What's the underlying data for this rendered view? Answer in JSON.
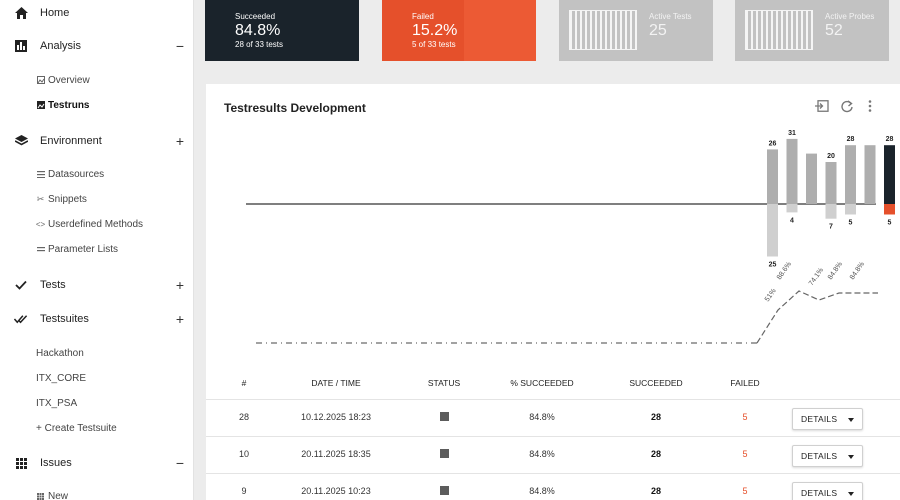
{
  "sidebar": {
    "home": {
      "label": "Home"
    },
    "analysis": {
      "label": "Analysis",
      "toggle": "−",
      "items": [
        {
          "label": "Overview"
        },
        {
          "label": "Testruns"
        }
      ]
    },
    "environment": {
      "label": "Environment",
      "toggle": "+",
      "items": [
        {
          "label": "Datasources"
        },
        {
          "label": "Snippets"
        },
        {
          "label": "Userdefined Methods"
        },
        {
          "label": "Parameter Lists"
        }
      ]
    },
    "tests": {
      "label": "Tests",
      "toggle": "+"
    },
    "testsuites": {
      "label": "Testsuites",
      "toggle": "+",
      "items": [
        {
          "label": "Hackathon"
        },
        {
          "label": "ITX_CORE"
        },
        {
          "label": "ITX_PSA"
        },
        {
          "label": "+ Create Testsuite"
        }
      ]
    },
    "issues": {
      "label": "Issues",
      "toggle": "−",
      "items": [
        {
          "label": "New"
        }
      ]
    }
  },
  "kpis": {
    "succeeded": {
      "title": "Succeeded",
      "value": "84.8%",
      "sub": "28 of 33 tests",
      "color": "#1a232b"
    },
    "failed": {
      "title": "Failed",
      "value": "15.2%",
      "sub": "5 of 33 tests",
      "color": "#e5502b"
    },
    "active_tests": {
      "title": "Active Tests",
      "value": "25"
    },
    "active_probes": {
      "title": "Active Probes",
      "value": "52"
    }
  },
  "card": {
    "title": "Testresults Development",
    "tools": [
      "import-icon",
      "refresh-icon",
      "more-vert-icon"
    ]
  },
  "chart_data": {
    "type": "bar",
    "series": [
      {
        "values": [
          26,
          31,
          24,
          20,
          28,
          28,
          28
        ]
      },
      {
        "values": [
          25,
          4,
          0,
          7,
          5,
          0,
          5
        ]
      }
    ],
    "bar_labels_top": [
      "26",
      "31",
      "",
      "20",
      "28",
      "",
      "28"
    ],
    "bar_labels_bottom": [
      "25",
      "4",
      "",
      "7",
      "5",
      "",
      "5"
    ],
    "percent_line": {
      "labels": [
        "51%",
        "88.6%",
        "74.1%",
        "84.8%",
        "84.8%"
      ]
    },
    "colors": {
      "success": "#aeaeae",
      "success_latest": "#1a232b",
      "failed": "#cfcfcf",
      "failed_latest": "#e5502b"
    }
  },
  "table": {
    "headers": [
      "#",
      "DATE / TIME",
      "STATUS",
      "% SUCCEEDED",
      "SUCCEEDED",
      "FAILED"
    ],
    "rows": [
      {
        "num": "28",
        "date": "10.12.2025 18:23",
        "pct": "84.8%",
        "succeeded": "28",
        "failed": "5",
        "action": "DETAILS"
      },
      {
        "num": "10",
        "date": "20.11.2025 18:35",
        "pct": "84.8%",
        "succeeded": "28",
        "failed": "5",
        "action": "DETAILS"
      },
      {
        "num": "9",
        "date": "20.11.2025 10:23",
        "pct": "84.8%",
        "succeeded": "28",
        "failed": "5",
        "action": "DETAILS"
      }
    ]
  }
}
